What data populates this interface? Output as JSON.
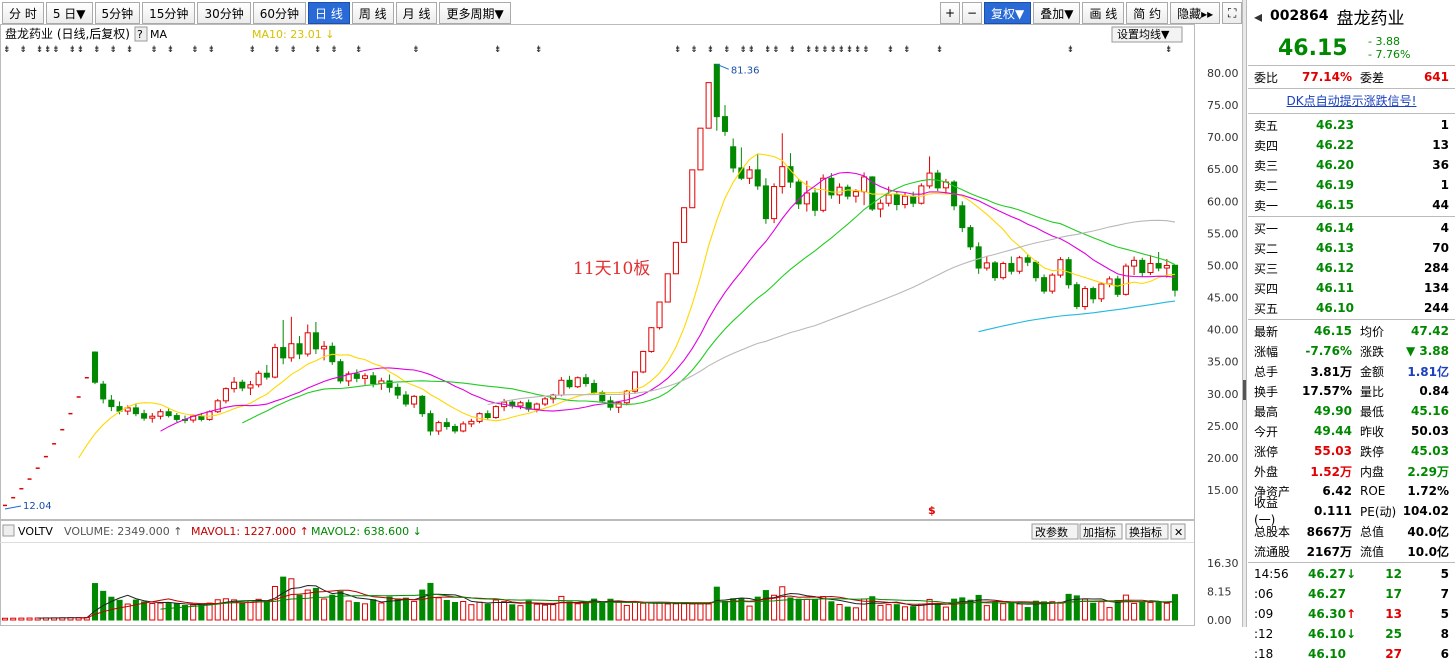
{
  "toolbar_left": {
    "buttons": [
      "分 时",
      "5 日▼",
      "5分钟",
      "15分钟",
      "30分钟",
      "60分钟",
      "日 线",
      "周 线",
      "月 线",
      "更多周期▼"
    ],
    "active_index": 6
  },
  "toolbar_right": {
    "plus": "+",
    "minus": "−",
    "fuquan": "复权▼",
    "diejia": "叠加▼",
    "huaxian": "画 线",
    "jianyue": "简 约",
    "yincang": "隐藏▸▸",
    "fullscreen": "⛶"
  },
  "chart_header": {
    "title": "盘龙药业 (日线,后复权)",
    "help": "?",
    "ma_label": "MA",
    "ma10": "MA10: 23.01",
    "set_ma_button": "设置均线▼",
    "annotation": "11天10板",
    "high_label": "81.36",
    "low_label": "12.04",
    "dollar": "$"
  },
  "price_axis": [
    "80.00",
    "75.00",
    "70.00",
    "65.00",
    "60.00",
    "55.00",
    "50.00",
    "45.00",
    "40.00",
    "35.00",
    "30.00",
    "25.00",
    "20.00",
    "15.00"
  ],
  "volume_header": {
    "name": "VOLTV",
    "volume": "VOLUME: 2349.000",
    "mavol1": "MAVOL1: 1227.000",
    "mavol2": "MAVOL2: 638.600",
    "btn_param": "改参数",
    "btn_add": "加指标",
    "btn_switch": "换指标",
    "btn_close": "✕"
  },
  "volume_axis": [
    "16.30",
    "8.15",
    "0.00"
  ],
  "chart_data": {
    "type": "candlestick",
    "title": "盘龙药业 (日线,后复权)",
    "price_range": [
      12,
      84
    ],
    "candles": [
      [
        12.04,
        12.6,
        12.04,
        12.6
      ],
      [
        12.6,
        13.8,
        12.6,
        13.8
      ],
      [
        13.8,
        15.2,
        13.8,
        15.2
      ],
      [
        15.2,
        16.7,
        15.2,
        16.7
      ],
      [
        16.7,
        18.4,
        16.7,
        18.4
      ],
      [
        18.4,
        20.2,
        18.4,
        20.2
      ],
      [
        20.2,
        22.2,
        20.2,
        22.2
      ],
      [
        22.2,
        24.4,
        22.2,
        24.4
      ],
      [
        24.4,
        26.9,
        24.4,
        26.9
      ],
      [
        26.9,
        29.5,
        26.9,
        29.5
      ],
      [
        29.5,
        32.5,
        29.5,
        32.5
      ],
      [
        36.5,
        36.6,
        31.5,
        31.8
      ],
      [
        31.5,
        32.0,
        28.5,
        29.2
      ],
      [
        29.0,
        29.8,
        27.3,
        28.0
      ],
      [
        28.0,
        28.8,
        26.8,
        27.3
      ],
      [
        27.3,
        28.2,
        26.7,
        27.8
      ],
      [
        27.8,
        28.5,
        26.5,
        26.9
      ],
      [
        26.9,
        27.5,
        25.8,
        26.2
      ],
      [
        26.2,
        27.0,
        25.5,
        26.5
      ],
      [
        26.5,
        27.6,
        26.0,
        27.2
      ],
      [
        27.2,
        27.8,
        26.3,
        26.6
      ],
      [
        26.6,
        27.0,
        25.6,
        26.0
      ],
      [
        26.0,
        26.6,
        25.4,
        25.9
      ],
      [
        25.9,
        26.8,
        25.5,
        26.5
      ],
      [
        26.5,
        27.0,
        25.7,
        26.0
      ],
      [
        26.0,
        27.4,
        25.8,
        27.2
      ],
      [
        27.2,
        29.2,
        27.0,
        28.9
      ],
      [
        28.9,
        31.0,
        28.5,
        30.8
      ],
      [
        30.8,
        32.6,
        30.2,
        31.8
      ],
      [
        31.8,
        32.2,
        30.4,
        30.9
      ],
      [
        30.9,
        32.0,
        29.8,
        31.4
      ],
      [
        31.4,
        33.6,
        31.0,
        33.2
      ],
      [
        33.2,
        34.5,
        32.2,
        32.6
      ],
      [
        32.6,
        37.8,
        32.4,
        37.2
      ],
      [
        37.2,
        41.5,
        34.6,
        35.6
      ],
      [
        35.6,
        42.0,
        35.0,
        37.8
      ],
      [
        37.8,
        39.0,
        35.4,
        36.2
      ],
      [
        36.2,
        40.8,
        35.8,
        39.5
      ],
      [
        39.5,
        41.2,
        36.2,
        37.0
      ],
      [
        37.0,
        38.2,
        35.2,
        37.4
      ],
      [
        37.4,
        38.0,
        34.5,
        35.0
      ],
      [
        35.0,
        35.4,
        31.6,
        32.0
      ],
      [
        32.0,
        33.5,
        31.2,
        33.1
      ],
      [
        33.1,
        33.8,
        31.8,
        32.4
      ],
      [
        32.4,
        33.2,
        31.4,
        32.8
      ],
      [
        32.8,
        33.4,
        31.0,
        31.6
      ],
      [
        31.6,
        32.5,
        30.6,
        32.0
      ],
      [
        32.0,
        33.0,
        30.2,
        31.0
      ],
      [
        31.0,
        31.6,
        29.2,
        29.8
      ],
      [
        29.8,
        30.4,
        28.0,
        28.4
      ],
      [
        28.4,
        29.8,
        27.8,
        29.6
      ],
      [
        29.6,
        29.8,
        26.4,
        26.9
      ],
      [
        26.9,
        27.4,
        23.5,
        24.2
      ],
      [
        24.2,
        25.8,
        23.6,
        25.5
      ],
      [
        25.5,
        26.2,
        24.4,
        24.9
      ],
      [
        24.9,
        25.3,
        23.8,
        24.2
      ],
      [
        24.2,
        25.7,
        24.0,
        25.3
      ],
      [
        25.3,
        26.1,
        24.8,
        25.7
      ],
      [
        25.7,
        27.1,
        25.4,
        26.9
      ],
      [
        26.9,
        27.4,
        26.0,
        26.3
      ],
      [
        26.3,
        28.2,
        26.1,
        28.0
      ],
      [
        28.0,
        29.2,
        27.3,
        28.7
      ],
      [
        28.7,
        29.1,
        27.7,
        28.1
      ],
      [
        28.1,
        28.9,
        27.6,
        28.6
      ],
      [
        28.6,
        29.1,
        27.2,
        27.6
      ],
      [
        27.6,
        28.6,
        27.1,
        28.4
      ],
      [
        28.4,
        29.5,
        28.1,
        29.2
      ],
      [
        29.2,
        30.0,
        28.5,
        29.8
      ],
      [
        29.8,
        32.6,
        29.6,
        32.1
      ],
      [
        32.1,
        32.8,
        30.8,
        31.1
      ],
      [
        31.1,
        32.7,
        30.9,
        32.5
      ],
      [
        32.5,
        33.1,
        31.1,
        31.6
      ],
      [
        31.6,
        32.2,
        29.8,
        30.2
      ],
      [
        30.2,
        30.5,
        28.6,
        28.9
      ],
      [
        28.9,
        29.6,
        27.4,
        27.9
      ],
      [
        27.9,
        28.8,
        27.0,
        28.6
      ],
      [
        28.6,
        30.6,
        28.2,
        30.4
      ],
      [
        30.4,
        33.5,
        30.0,
        33.4
      ],
      [
        33.4,
        36.7,
        33.2,
        36.6
      ],
      [
        36.6,
        40.4,
        36.4,
        40.3
      ],
      [
        40.3,
        44.3,
        40.0,
        44.3
      ],
      [
        44.3,
        48.7,
        44.3,
        48.7
      ],
      [
        48.7,
        53.6,
        48.7,
        53.6
      ],
      [
        53.6,
        59.0,
        53.6,
        59.0
      ],
      [
        59.0,
        64.9,
        59.0,
        64.9
      ],
      [
        64.9,
        71.4,
        64.9,
        71.4
      ],
      [
        71.4,
        78.5,
        71.4,
        78.5
      ],
      [
        81.36,
        81.36,
        71.0,
        73.2
      ],
      [
        73.2,
        75.0,
        70.2,
        70.9
      ],
      [
        68.5,
        69.8,
        64.5,
        65.2
      ],
      [
        65.2,
        68.4,
        63.3,
        63.6
      ],
      [
        63.6,
        65.5,
        62.7,
        64.9
      ],
      [
        64.9,
        67.4,
        61.8,
        62.4
      ],
      [
        62.4,
        63.6,
        56.5,
        57.3
      ],
      [
        57.3,
        62.8,
        56.6,
        62.3
      ],
      [
        62.3,
        70.6,
        61.2,
        65.4
      ],
      [
        65.4,
        67.5,
        62.1,
        63.0
      ],
      [
        63.0,
        63.5,
        58.8,
        59.6
      ],
      [
        59.6,
        63.2,
        58.4,
        61.3
      ],
      [
        61.3,
        62.1,
        57.7,
        58.6
      ],
      [
        58.6,
        64.2,
        58.3,
        63.6
      ],
      [
        63.6,
        64.4,
        60.4,
        61.0
      ],
      [
        61.0,
        62.8,
        59.6,
        62.2
      ],
      [
        62.2,
        62.6,
        60.3,
        60.8
      ],
      [
        60.8,
        61.9,
        59.8,
        61.5
      ],
      [
        61.5,
        64.5,
        59.4,
        63.8
      ],
      [
        63.8,
        63.9,
        58.5,
        58.8
      ],
      [
        58.8,
        60.3,
        57.5,
        59.7
      ],
      [
        59.7,
        62.3,
        59.2,
        61.0
      ],
      [
        61.0,
        61.6,
        58.6,
        59.5
      ],
      [
        59.5,
        61.3,
        58.9,
        60.8
      ],
      [
        60.8,
        61.5,
        59.1,
        59.7
      ],
      [
        59.7,
        62.8,
        59.5,
        62.4
      ],
      [
        62.4,
        67.0,
        62.0,
        64.4
      ],
      [
        64.4,
        64.9,
        61.6,
        62.1
      ],
      [
        62.1,
        63.5,
        61.1,
        63.0
      ],
      [
        63.0,
        63.3,
        58.6,
        59.3
      ],
      [
        59.3,
        60.0,
        55.2,
        55.9
      ],
      [
        55.9,
        56.3,
        52.4,
        52.9
      ],
      [
        52.9,
        53.6,
        48.7,
        49.6
      ],
      [
        49.6,
        51.5,
        49.2,
        50.4
      ],
      [
        50.4,
        50.7,
        47.6,
        48.1
      ],
      [
        48.1,
        50.6,
        47.8,
        50.3
      ],
      [
        50.3,
        51.4,
        48.6,
        49.1
      ],
      [
        49.1,
        51.5,
        48.7,
        51.2
      ],
      [
        51.2,
        51.7,
        49.9,
        50.5
      ],
      [
        50.5,
        50.8,
        47.5,
        48.1
      ],
      [
        48.1,
        48.6,
        45.6,
        46.0
      ],
      [
        46.0,
        48.8,
        45.6,
        48.5
      ],
      [
        48.5,
        51.3,
        48.1,
        50.9
      ],
      [
        50.9,
        51.3,
        46.4,
        47.0
      ],
      [
        47.0,
        47.4,
        43.2,
        43.6
      ],
      [
        43.6,
        46.8,
        43.1,
        46.4
      ],
      [
        46.4,
        46.7,
        44.1,
        44.8
      ],
      [
        44.8,
        47.4,
        44.3,
        47.1
      ],
      [
        47.1,
        48.3,
        46.6,
        47.9
      ],
      [
        47.9,
        48.4,
        45.1,
        45.5
      ],
      [
        45.5,
        50.3,
        45.3,
        49.9
      ],
      [
        49.9,
        51.4,
        48.5,
        50.8
      ],
      [
        50.8,
        51.2,
        48.2,
        48.9
      ],
      [
        48.9,
        51.6,
        48.5,
        50.3
      ],
      [
        50.3,
        52.1,
        49.1,
        49.6
      ],
      [
        49.6,
        51.0,
        48.1,
        50.0
      ],
      [
        50.03,
        49.9,
        45.16,
        46.15
      ]
    ],
    "ma_lines": [
      {
        "name": "MA10",
        "color": "#ffd800"
      },
      {
        "name": "MA20",
        "color": "#e000e0"
      },
      {
        "name": "MA30",
        "color": "#22cc22"
      },
      {
        "name": "MA60",
        "color": "#b8b8b8"
      },
      {
        "name": "MA120",
        "color": "#22b8e0"
      }
    ],
    "volume_range": [
      0,
      16.3
    ]
  },
  "stock": {
    "code": "002864",
    "name": "盘龙药业",
    "price": "46.15",
    "change": "- 3.88",
    "change_pct": "- 7.76%"
  },
  "weibi": {
    "label1": "委比",
    "value1": "77.14%",
    "label2": "委差",
    "value2": "641"
  },
  "dk_link": "DK点自动提示涨跌信号!",
  "sell_orders": [
    {
      "label": "卖五",
      "price": "46.23",
      "qty": "1"
    },
    {
      "label": "卖四",
      "price": "46.22",
      "qty": "13"
    },
    {
      "label": "卖三",
      "price": "46.20",
      "qty": "36"
    },
    {
      "label": "卖二",
      "price": "46.19",
      "qty": "1"
    },
    {
      "label": "卖一",
      "price": "46.15",
      "qty": "44"
    }
  ],
  "buy_orders": [
    {
      "label": "买一",
      "price": "46.14",
      "qty": "4"
    },
    {
      "label": "买二",
      "price": "46.13",
      "qty": "70"
    },
    {
      "label": "买三",
      "price": "46.12",
      "qty": "284"
    },
    {
      "label": "买四",
      "price": "46.11",
      "qty": "134"
    },
    {
      "label": "买五",
      "price": "46.10",
      "qty": "244"
    }
  ],
  "quote": [
    {
      "l1": "最新",
      "v1": "46.15",
      "c1": "grn",
      "l2": "均价",
      "v2": "47.42",
      "c2": "grn"
    },
    {
      "l1": "涨幅",
      "v1": "-7.76%",
      "c1": "grn",
      "l2": "涨跌",
      "v2": "▼ 3.88",
      "c2": "grn"
    },
    {
      "l1": "总手",
      "v1": "3.81万",
      "c1": "",
      "l2": "金额",
      "v2": "1.81亿",
      "c2": "blu"
    },
    {
      "l1": "换手",
      "v1": "17.57%",
      "c1": "",
      "l2": "量比",
      "v2": "0.84",
      "c2": ""
    },
    {
      "l1": "最高",
      "v1": "49.90",
      "c1": "grn",
      "l2": "最低",
      "v2": "45.16",
      "c2": "grn"
    },
    {
      "l1": "今开",
      "v1": "49.44",
      "c1": "grn",
      "l2": "昨收",
      "v2": "50.03",
      "c2": ""
    },
    {
      "l1": "涨停",
      "v1": "55.03",
      "c1": "red",
      "l2": "跌停",
      "v2": "45.03",
      "c2": "grn"
    },
    {
      "l1": "外盘",
      "v1": "1.52万",
      "c1": "red",
      "l2": "内盘",
      "v2": "2.29万",
      "c2": "grn"
    },
    {
      "l1": "净资产",
      "v1": "6.42",
      "c1": "",
      "l2": "ROE",
      "v2": "1.72%",
      "c2": ""
    },
    {
      "l1": "收益(一)",
      "v1": "0.111",
      "c1": "",
      "l2": "PE(动)",
      "v2": "104.02",
      "c2": ""
    },
    {
      "l1": "总股本",
      "v1": "8667万",
      "c1": "",
      "l2": "总值",
      "v2": "40.0亿",
      "c2": ""
    },
    {
      "l1": "流通股",
      "v1": "2167万",
      "c1": "",
      "l2": "流值",
      "v2": "10.0亿",
      "c2": ""
    }
  ],
  "ticks": [
    {
      "time": "14:56",
      "price": "46.27",
      "arrow": "↓",
      "ac": "grn",
      "vol": "12",
      "vc": "grn",
      "num": "5"
    },
    {
      "time": ":06",
      "price": "46.27",
      "arrow": "",
      "ac": "",
      "vol": "17",
      "vc": "grn",
      "num": "7"
    },
    {
      "time": ":09",
      "price": "46.30",
      "arrow": "↑",
      "ac": "red",
      "vol": "13",
      "vc": "red",
      "num": "5"
    },
    {
      "time": ":12",
      "price": "46.10",
      "arrow": "↓",
      "ac": "grn",
      "vol": "25",
      "vc": "grn",
      "num": "8"
    },
    {
      "time": ":18",
      "price": "46.10",
      "arrow": "",
      "ac": "",
      "vol": "27",
      "vc": "red",
      "num": "6"
    }
  ],
  "colors": {
    "up": "#e00000",
    "down": "#008800",
    "accent": "#2a6ad6"
  }
}
